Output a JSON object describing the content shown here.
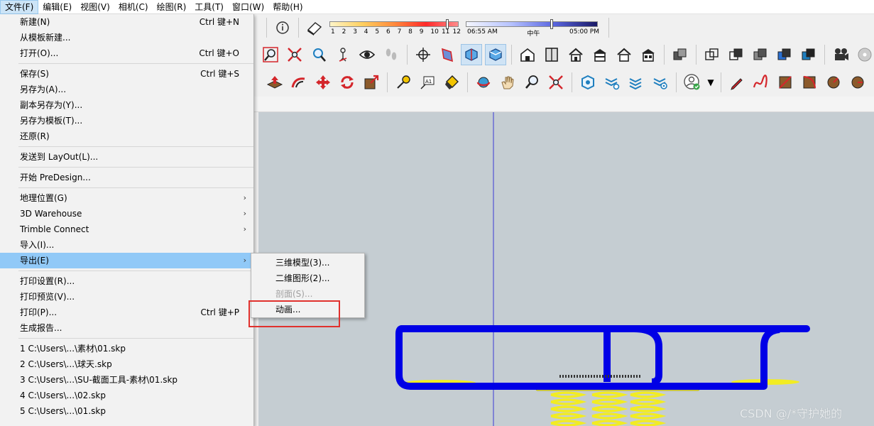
{
  "menubar": {
    "items": [
      {
        "label": "文件(F)"
      },
      {
        "label": "编辑(E)"
      },
      {
        "label": "视图(V)"
      },
      {
        "label": "相机(C)"
      },
      {
        "label": "绘图(R)"
      },
      {
        "label": "工具(T)"
      },
      {
        "label": "窗口(W)"
      },
      {
        "label": "帮助(H)"
      }
    ]
  },
  "file_menu": {
    "items": [
      {
        "label": "新建(N)",
        "shortcut": "Ctrl 键+N"
      },
      {
        "label": "从模板新建..."
      },
      {
        "label": "打开(O)...",
        "shortcut": "Ctrl 键+O"
      },
      {
        "label": "保存(S)",
        "shortcut": "Ctrl 键+S"
      },
      {
        "label": "另存为(A)..."
      },
      {
        "label": "副本另存为(Y)..."
      },
      {
        "label": "另存为模板(T)..."
      },
      {
        "label": "还原(R)"
      },
      {
        "label": "发送到 LayOut(L)..."
      },
      {
        "label": "开始 PreDesign..."
      },
      {
        "label": "地理位置(G)"
      },
      {
        "label": "3D Warehouse"
      },
      {
        "label": "Trimble Connect"
      },
      {
        "label": "导入(I)..."
      },
      {
        "label": "导出(E)"
      },
      {
        "label": "打印设置(R)..."
      },
      {
        "label": "打印预览(V)..."
      },
      {
        "label": "打印(P)...",
        "shortcut": "Ctrl 键+P"
      },
      {
        "label": "生成报告..."
      },
      {
        "label": "1 C:\\Users\\...\\素材\\01.skp"
      },
      {
        "label": "2 C:\\Users\\...\\球天.skp"
      },
      {
        "label": "3 C:\\Users\\...\\SU-截面工具-素材\\01.skp"
      },
      {
        "label": "4 C:\\Users\\...\\02.skp"
      },
      {
        "label": "5 C:\\Users\\...\\01.skp"
      }
    ],
    "submenu_arrow": "›"
  },
  "export_submenu": {
    "items": [
      {
        "label": "三维模型(3)..."
      },
      {
        "label": "二维图形(2)..."
      },
      {
        "label": "剖面(S)..."
      },
      {
        "label": "动画..."
      }
    ]
  },
  "shadow": {
    "months": [
      "1",
      "2",
      "3",
      "4",
      "5",
      "6",
      "7",
      "8",
      "9",
      "10",
      "11",
      "12"
    ],
    "date_position": 0.91,
    "time_start": "06:55 AM",
    "time_noon": "中午",
    "time_end": "05:00 PM",
    "time_position": 0.65
  },
  "watermark": "CSDN @/*守护她的",
  "colors": {
    "menu_highlight": "#91c9f7",
    "model_blue": "#0000e6",
    "model_yellow": "#f2ec22",
    "annotation_red": "#e0312d"
  }
}
